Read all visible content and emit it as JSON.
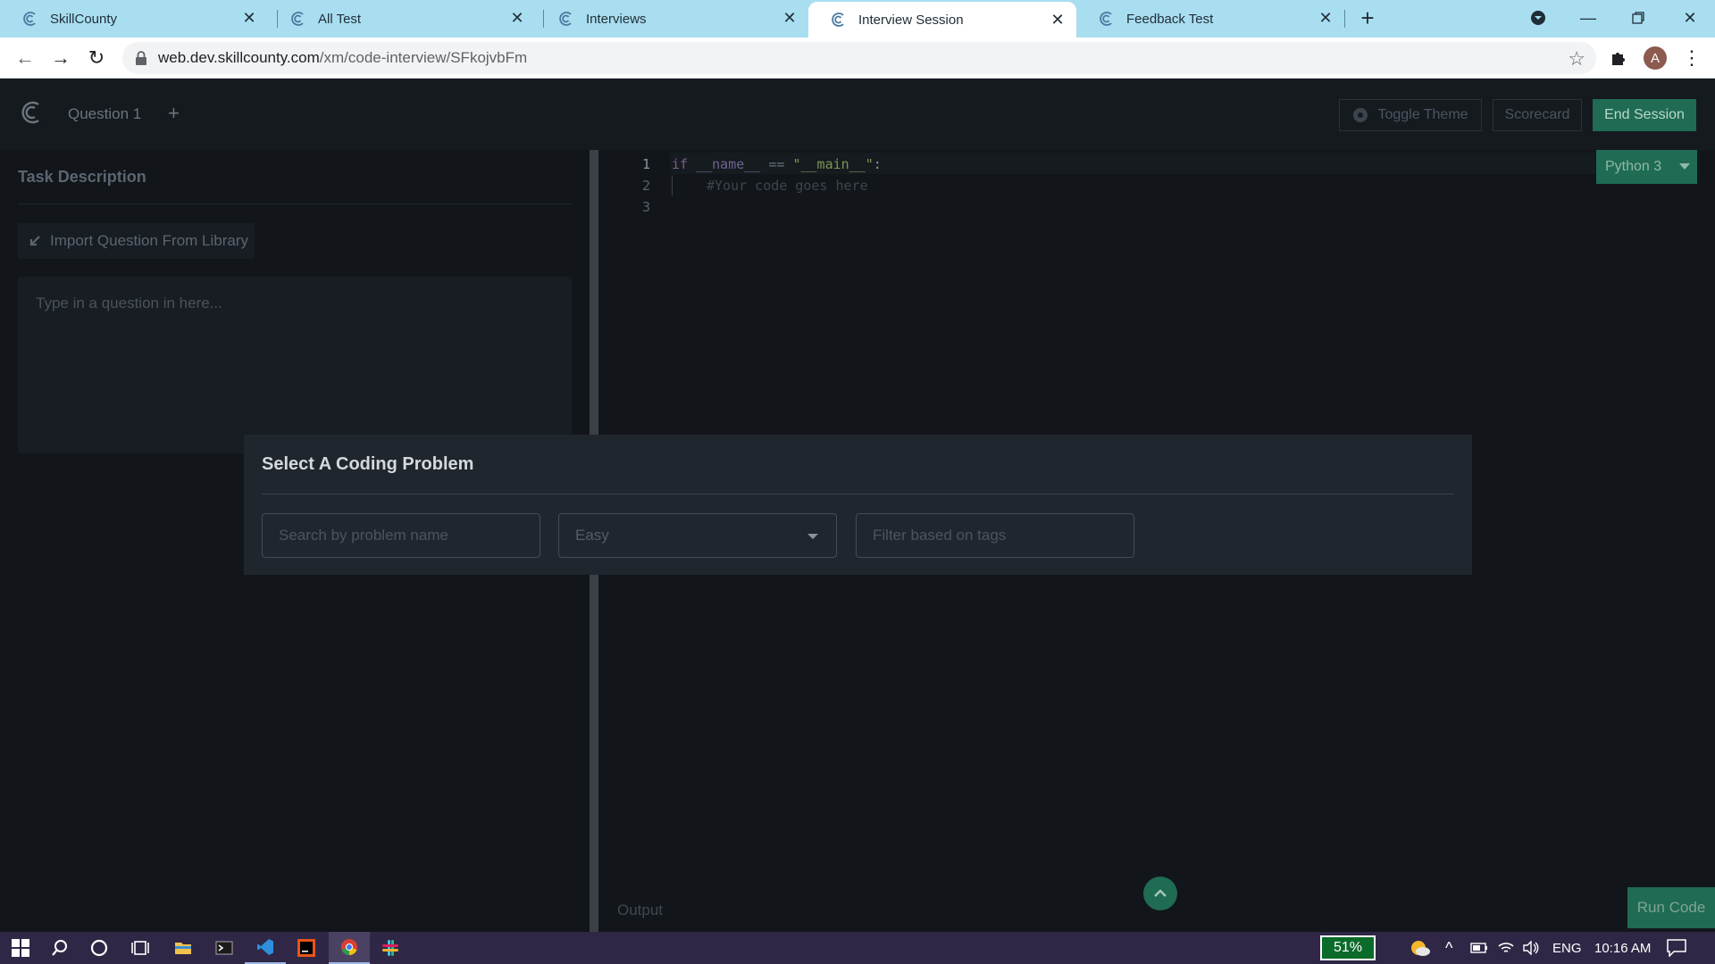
{
  "browser": {
    "tabs": [
      {
        "title": "SkillCounty",
        "active": false
      },
      {
        "title": "All Test",
        "active": false
      },
      {
        "title": "Interviews",
        "active": false
      },
      {
        "title": "Interview Session",
        "active": true
      },
      {
        "title": "Feedback Test",
        "active": false
      }
    ],
    "url_host": "web.dev.skillcounty.com",
    "url_path": "/xm/code-interview/SFkojvbFm",
    "profile_initial": "A"
  },
  "app": {
    "question_tab": "Question 1",
    "add_question": "+",
    "toggle_theme": "Toggle Theme",
    "scorecard": "Scorecard",
    "end_session": "End Session"
  },
  "left_panel": {
    "task_description": "Task Description",
    "import_button": "Import Question From Library",
    "question_placeholder": "Type in a question in here..."
  },
  "editor": {
    "language": "Python 3",
    "line_numbers": [
      "1",
      "2",
      "3"
    ],
    "line1": {
      "kw": "if",
      "sp1": " ",
      "dunder": "__name__",
      "op": " == ",
      "str": "\"__main__\"",
      "colon": ":"
    },
    "line2_comment": "#Your code goes here",
    "output_label": "Output",
    "run_code": "Run Code"
  },
  "modal": {
    "title": "Select A Coding Problem",
    "search_placeholder": "Search by problem name",
    "difficulty": "Easy",
    "tags_placeholder": "Filter based on tags"
  },
  "taskbar": {
    "battery": "51%",
    "language": "ENG",
    "time": "10:16 AM"
  },
  "colors": {
    "accent": "#1f6b53",
    "tab_strip": "#a9def1",
    "taskbar": "#2f2745"
  }
}
